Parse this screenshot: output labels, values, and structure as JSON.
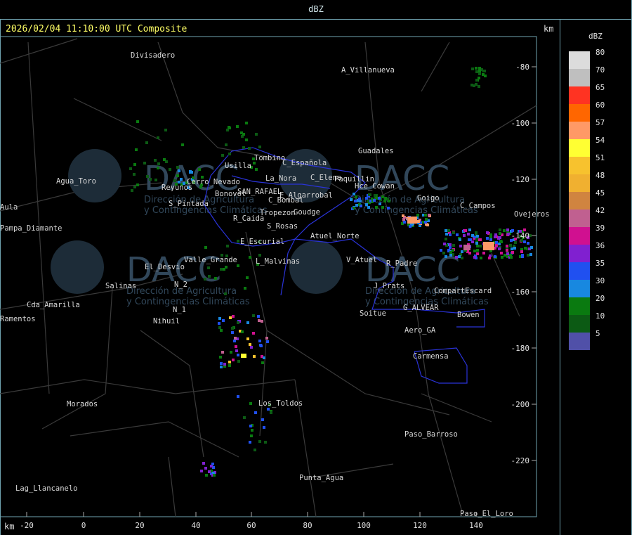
{
  "header": {
    "title": "dBZ"
  },
  "map": {
    "timestamp": "2026/02/04 11:10:00 UTC Composite",
    "km_label_top": "km",
    "km_label_bottom": "km",
    "x_ticks": [
      "-20",
      "0",
      "20",
      "40",
      "60",
      "80",
      "100",
      "120",
      "140"
    ],
    "y_ticks": [
      "-80",
      "-100",
      "-120",
      "-140",
      "-160",
      "-180",
      "-200",
      "-220"
    ],
    "watermark": {
      "brand": "DACC",
      "line1": "Dirección de Agricultura",
      "line2": "y Contingencias Climáticas"
    }
  },
  "places": [
    "Divisadero",
    "A_Villanueva",
    "Guadales",
    "Tombino",
    "Usilla",
    "C_Española",
    "La_Nora",
    "C_Elena",
    "Paquillin",
    "Hce_Cowan",
    "Goigo",
    "C_Campos",
    "Ovejeros",
    "Reyunos",
    "Cerro_Nevado",
    "S_Pintada",
    "Bonovol",
    "SAN_RAFAEL",
    "E_Algarrobal",
    "C_Bombal",
    "Tropezon",
    "Goudge",
    "R_Caida",
    "S_Rosas",
    "Atuel_Norte",
    "E_Escurial",
    "Valle_Grande",
    "L_Malvinas",
    "V_Atuel",
    "R_Padre",
    "El_Desvio",
    "Salinas",
    "N_2",
    "N_1",
    "Nihuil",
    "J_Prats",
    "CompartEscard",
    "G_ALVEAR",
    "Bowen",
    "Soitue",
    "Aero_GA",
    "Carmensa",
    "Cda_Amarilla",
    "Ramentos",
    "Pampa_Diamante",
    "Agua_Toro",
    "Aula",
    "Morados",
    "Los_Toldos",
    "Paso_Barroso",
    "Punta_Agua",
    "Lag_Llancanelo",
    "Paso_El_Loro"
  ],
  "legend": {
    "title": "dBZ",
    "levels": [
      {
        "label": "80",
        "color": "#dcdcdc"
      },
      {
        "label": "70",
        "color": "#bfbfbf"
      },
      {
        "label": "65",
        "color": "#ff3322"
      },
      {
        "label": "60",
        "color": "#ff6600"
      },
      {
        "label": "57",
        "color": "#ff9966"
      },
      {
        "label": "54",
        "color": "#ffff33"
      },
      {
        "label": "51",
        "color": "#f7c22e"
      },
      {
        "label": "48",
        "color": "#f0b030"
      },
      {
        "label": "45",
        "color": "#d08440"
      },
      {
        "label": "42",
        "color": "#c06090"
      },
      {
        "label": "39",
        "color": "#d01090"
      },
      {
        "label": "36",
        "color": "#8020d0"
      },
      {
        "label": "35",
        "color": "#2050f0"
      },
      {
        "label": "30",
        "color": "#1888e0"
      },
      {
        "label": "20",
        "color": "#0a7a10"
      },
      {
        "label": "10",
        "color": "#0c5a14"
      },
      {
        "label": "5",
        "color": "#5050a8"
      }
    ]
  }
}
